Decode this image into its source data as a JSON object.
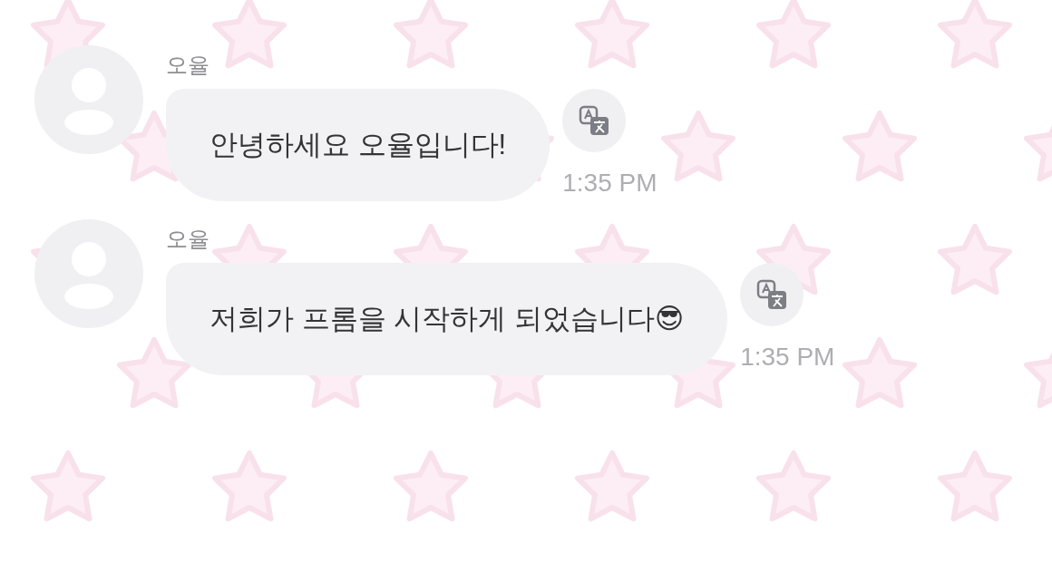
{
  "messages": [
    {
      "sender": "오율",
      "text": "안녕하세요 오율입니다!",
      "time": "1:35 PM"
    },
    {
      "sender": "오율",
      "text": "저희가 프롬을 시작하게 되었습니다😎",
      "time": "1:35 PM"
    }
  ]
}
